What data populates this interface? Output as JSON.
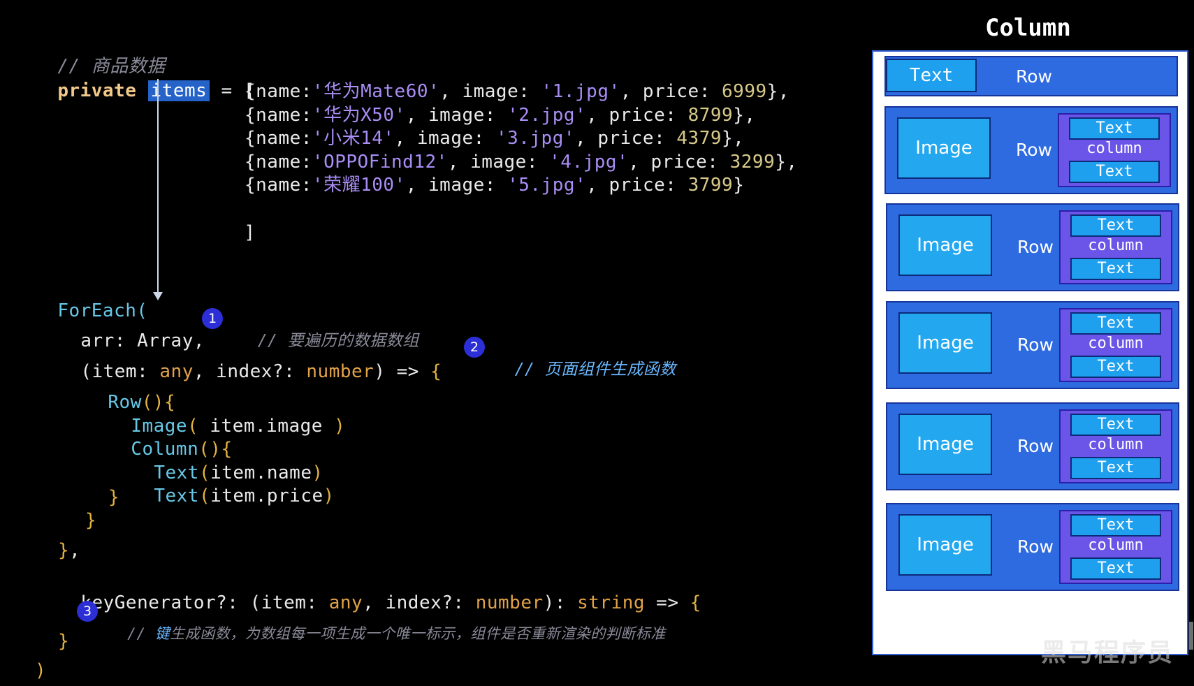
{
  "code": {
    "comment_top": "// 商品数据",
    "private_kw": "private",
    "items_sel": "items",
    "assign": " = [",
    "data_rows": [
      {
        "name": "'华为Mate60'",
        "image": "'1.jpg'",
        "price": "6999",
        "end": "},"
      },
      {
        "name": "'华为X50'",
        "image": "'2.jpg'",
        "price": "8799",
        "end": "},"
      },
      {
        "name": "'小米14'",
        "image": "'3.jpg'",
        "price": "4379",
        "end": "},"
      },
      {
        "name": "'OPPOFind12'",
        "image": "'4.jpg'",
        "price": "3299",
        "end": "},"
      },
      {
        "name": "'荣耀100'",
        "image": "'5.jpg'",
        "price": "3799",
        "end": "}"
      }
    ],
    "close_bracket": "]",
    "foreach": "ForEach(",
    "arr_line": "arr: Array,",
    "comment_1": "// 要遍历的数据数组",
    "comment_2": "// 页面组件生成函数",
    "row_call": "Row",
    "image_call": "Image",
    "image_arg": " item.image ",
    "column_call": "Column",
    "text_call": "Text",
    "text_arg_1": "item.name",
    "text_arg_2": "item.price",
    "key_gen": "keyGenerator?:",
    "comment_3_hl": "键",
    "comment_3_rest": "生成函数，为数组每一项生成一个唯一标示，组件是否重新渲染的判断标准",
    "badge_1": "1",
    "badge_2": "2",
    "badge_3": "3"
  },
  "diagram": {
    "title": "Column",
    "header_row": {
      "text": "Text",
      "label": "Row"
    },
    "item_rows": [
      {
        "image": "Image",
        "label": "Row",
        "text_top": "Text",
        "column": "column",
        "text_bottom": "Text"
      },
      {
        "image": "Image",
        "label": "Row",
        "text_top": "Text",
        "column": "column",
        "text_bottom": "Text"
      },
      {
        "image": "Image",
        "label": "Row",
        "text_top": "Text",
        "column": "column",
        "text_bottom": "Text"
      },
      {
        "image": "Image",
        "label": "Row",
        "text_top": "Text",
        "column": "column",
        "text_bottom": "Text"
      },
      {
        "image": "Image",
        "label": "Row",
        "text_top": "Text",
        "column": "column",
        "text_bottom": "Text"
      }
    ]
  },
  "watermark": "黑马程序员",
  "colors": {
    "row_blue": "#2e6ae0",
    "text_cyan": "#1fa0ee",
    "column_purple": "#6b55e8",
    "badge": "#2c2fd6"
  }
}
